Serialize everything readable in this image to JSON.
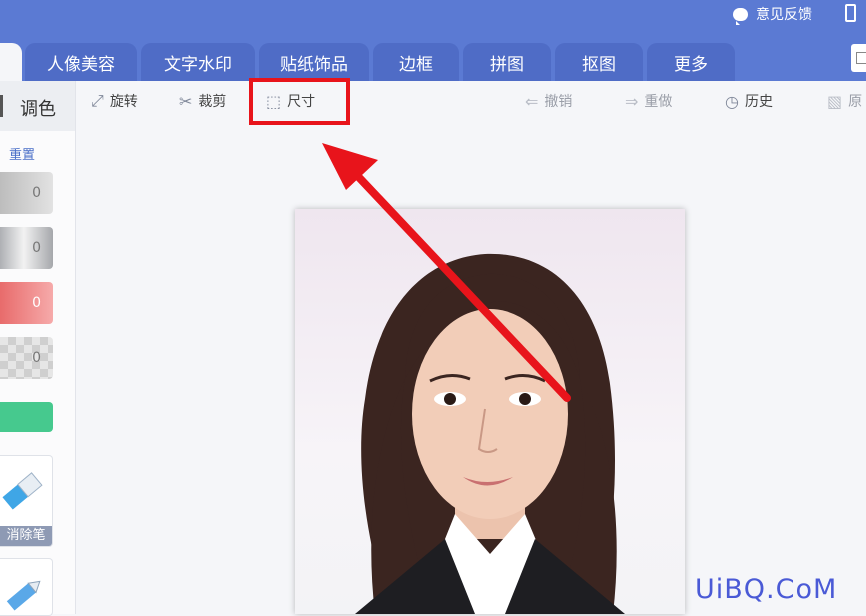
{
  "header": {
    "feedback_label": "意见反馈"
  },
  "tabs": [
    "人像美容",
    "文字水印",
    "贴纸饰品",
    "边框",
    "拼图",
    "抠图",
    "更多"
  ],
  "sidebar": {
    "section_title": "调色",
    "reset_label": "重置",
    "sliders": [
      {
        "value": "0"
      },
      {
        "value": "0"
      },
      {
        "value": "0"
      },
      {
        "value": "0"
      }
    ],
    "tools": [
      {
        "label": "消除笔"
      }
    ]
  },
  "toolbar": {
    "rotate_label": "旋转",
    "crop_label": "裁剪",
    "size_label": "尺寸",
    "undo_label": "撤销",
    "redo_label": "重做",
    "history_label": "历史",
    "original_label": "原"
  },
  "annotation": {
    "color": "#e8141b"
  },
  "watermark": "UiBQ.CoM"
}
